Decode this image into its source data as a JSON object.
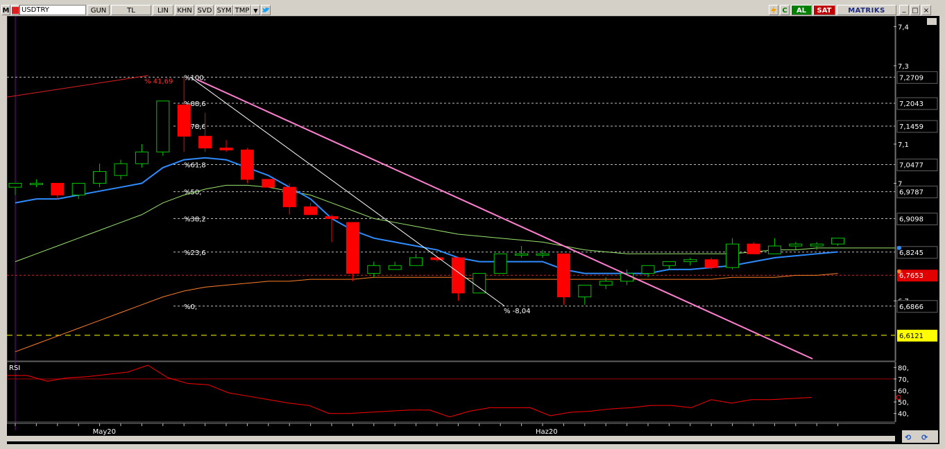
{
  "toolbar": {
    "m_label": "M",
    "symbol": "USDTRY",
    "buttons": [
      "GUN",
      "TL",
      "LIN",
      "KHN",
      "SVD",
      "SYM",
      "TMP"
    ],
    "refresh_icon": "refresh-icon",
    "c_label": "C",
    "buy_label": "AL",
    "sell_label": "SAT",
    "brand": "MATRIKS",
    "window_controls": [
      "_",
      "□",
      "×"
    ]
  },
  "colors": {
    "up_candle": "#00c800",
    "down_candle": "#ff0000",
    "ma_fast": "#2f8cff",
    "ma_mid": "#9ae66b",
    "ma_slow": "#ff7f27",
    "trendline": "#ff80d0",
    "fib_line": "#ffffff",
    "rsi_line": "#ff0000",
    "yellow_line": "#ffff00",
    "red_level": "#ff3030"
  },
  "chart": {
    "price_axis_ticks": [
      "7,4",
      "7,3",
      "7,1",
      "7",
      "6,7"
    ],
    "price_tick_values": [
      7.4,
      7.3,
      7.1,
      7.0,
      6.7
    ],
    "level_labels": [
      {
        "value": 7.2709,
        "text": "7,2709",
        "style": "plain"
      },
      {
        "value": 7.2043,
        "text": "7,2043",
        "style": "plain"
      },
      {
        "value": 7.1459,
        "text": "7,1459",
        "style": "plain"
      },
      {
        "value": 7.0477,
        "text": "7,0477",
        "style": "plain"
      },
      {
        "value": 6.9787,
        "text": "6,9787",
        "style": "plain"
      },
      {
        "value": 6.9098,
        "text": "6,9098",
        "style": "plain"
      },
      {
        "value": 6.8245,
        "text": "6,8245",
        "style": "plain"
      },
      {
        "value": 6.7653,
        "text": "6,7653",
        "style": "red"
      },
      {
        "value": 6.6866,
        "text": "6,6866",
        "style": "plain"
      },
      {
        "value": 6.6121,
        "text": "6,6121",
        "style": "yellow"
      }
    ],
    "fib_labels": [
      {
        "value": 7.2709,
        "text": "%100,"
      },
      {
        "value": 7.2043,
        "text": "%88,6"
      },
      {
        "value": 7.1459,
        "text": "%78,6"
      },
      {
        "value": 7.0477,
        "text": "%61,8"
      },
      {
        "value": 6.9787,
        "text": "%50,"
      },
      {
        "value": 6.9098,
        "text": "%38,2"
      },
      {
        "value": 6.8245,
        "text": "%23,6"
      },
      {
        "value": 6.6866,
        "text": "%0,"
      }
    ],
    "annotations": [
      "% 41,69",
      "% -8,04"
    ],
    "candles": [
      {
        "o": 6.99,
        "h": 7.0,
        "l": 6.97,
        "c": 7.0
      },
      {
        "o": 7.0,
        "h": 7.01,
        "l": 6.99,
        "c": 7.0
      },
      {
        "o": 7.0,
        "h": 7.0,
        "l": 6.96,
        "c": 6.97
      },
      {
        "o": 6.97,
        "h": 7.0,
        "l": 6.96,
        "c": 7.0
      },
      {
        "o": 7.0,
        "h": 7.05,
        "l": 6.99,
        "c": 7.03
      },
      {
        "o": 7.02,
        "h": 7.06,
        "l": 7.01,
        "c": 7.05
      },
      {
        "o": 7.05,
        "h": 7.1,
        "l": 7.04,
        "c": 7.08
      },
      {
        "o": 7.08,
        "h": 7.21,
        "l": 7.07,
        "c": 7.21
      },
      {
        "o": 7.2,
        "h": 7.27,
        "l": 7.08,
        "c": 7.12
      },
      {
        "o": 7.12,
        "h": 7.18,
        "l": 7.08,
        "c": 7.09
      },
      {
        "o": 7.09,
        "h": 7.11,
        "l": 7.08,
        "c": 7.085
      },
      {
        "o": 7.085,
        "h": 7.09,
        "l": 7.0,
        "c": 7.01
      },
      {
        "o": 7.01,
        "h": 7.01,
        "l": 6.99,
        "c": 6.99
      },
      {
        "o": 6.99,
        "h": 7.0,
        "l": 6.92,
        "c": 6.94
      },
      {
        "o": 6.94,
        "h": 6.95,
        "l": 6.92,
        "c": 6.92
      },
      {
        "o": 6.915,
        "h": 6.92,
        "l": 6.85,
        "c": 6.91
      },
      {
        "o": 6.9,
        "h": 6.9,
        "l": 6.75,
        "c": 6.77
      },
      {
        "o": 6.77,
        "h": 6.8,
        "l": 6.76,
        "c": 6.79
      },
      {
        "o": 6.78,
        "h": 6.8,
        "l": 6.78,
        "c": 6.79
      },
      {
        "o": 6.79,
        "h": 6.82,
        "l": 6.79,
        "c": 6.81
      },
      {
        "o": 6.81,
        "h": 6.81,
        "l": 6.8,
        "c": 6.805
      },
      {
        "o": 6.81,
        "h": 6.81,
        "l": 6.7,
        "c": 6.72
      },
      {
        "o": 6.72,
        "h": 6.77,
        "l": 6.72,
        "c": 6.77
      },
      {
        "o": 6.77,
        "h": 6.82,
        "l": 6.77,
        "c": 6.82
      },
      {
        "o": 6.82,
        "h": 6.84,
        "l": 6.81,
        "c": 6.82
      },
      {
        "o": 6.82,
        "h": 6.83,
        "l": 6.81,
        "c": 6.82
      },
      {
        "o": 6.82,
        "h": 6.82,
        "l": 6.69,
        "c": 6.71
      },
      {
        "o": 6.71,
        "h": 6.74,
        "l": 6.69,
        "c": 6.74
      },
      {
        "o": 6.74,
        "h": 6.76,
        "l": 6.73,
        "c": 6.75
      },
      {
        "o": 6.75,
        "h": 6.78,
        "l": 6.74,
        "c": 6.77
      },
      {
        "o": 6.77,
        "h": 6.79,
        "l": 6.76,
        "c": 6.79
      },
      {
        "o": 6.79,
        "h": 6.8,
        "l": 6.78,
        "c": 6.8
      },
      {
        "o": 6.8,
        "h": 6.81,
        "l": 6.79,
        "c": 6.805
      },
      {
        "o": 6.805,
        "h": 6.81,
        "l": 6.78,
        "c": 6.785
      },
      {
        "o": 6.785,
        "h": 6.86,
        "l": 6.78,
        "c": 6.845
      },
      {
        "o": 6.845,
        "h": 6.85,
        "l": 6.82,
        "c": 6.82
      },
      {
        "o": 6.82,
        "h": 6.86,
        "l": 6.82,
        "c": 6.84
      },
      {
        "o": 6.84,
        "h": 6.85,
        "l": 6.83,
        "c": 6.845
      },
      {
        "o": 6.84,
        "h": 6.85,
        "l": 6.83,
        "c": 6.845
      },
      {
        "o": 6.845,
        "h": 6.86,
        "l": 6.84,
        "c": 6.86
      }
    ],
    "ma_fast": [
      6.95,
      6.96,
      6.96,
      6.97,
      6.98,
      6.99,
      7.0,
      7.04,
      7.06,
      7.065,
      7.06,
      7.04,
      7.02,
      6.99,
      6.96,
      6.91,
      6.88,
      6.86,
      6.85,
      6.84,
      6.83,
      6.81,
      6.8,
      6.8,
      6.8,
      6.8,
      6.78,
      6.77,
      6.77,
      6.77,
      6.77,
      6.78,
      6.78,
      6.785,
      6.79,
      6.8,
      6.81,
      6.815,
      6.82,
      6.825
    ],
    "ma_mid": [
      6.8,
      6.82,
      6.84,
      6.86,
      6.88,
      6.9,
      6.92,
      6.95,
      6.97,
      6.985,
      6.995,
      6.995,
      6.99,
      6.98,
      6.97,
      6.95,
      6.93,
      6.91,
      6.9,
      6.89,
      6.88,
      6.87,
      6.865,
      6.86,
      6.855,
      6.85,
      6.84,
      6.83,
      6.825,
      6.82,
      6.82,
      6.82,
      6.82,
      6.82,
      6.82,
      6.825,
      6.83,
      6.83,
      6.835,
      6.835
    ],
    "ma_slow": [
      6.57,
      6.59,
      6.61,
      6.63,
      6.65,
      6.67,
      6.69,
      6.71,
      6.725,
      6.735,
      6.74,
      6.745,
      6.75,
      6.75,
      6.755,
      6.755,
      6.755,
      6.76,
      6.76,
      6.76,
      6.76,
      6.76,
      6.755,
      6.755,
      6.755,
      6.755,
      6.755,
      6.755,
      6.755,
      6.755,
      6.755,
      6.755,
      6.755,
      6.755,
      6.76,
      6.76,
      6.76,
      6.765,
      6.765,
      6.77
    ],
    "x_labels": [
      {
        "index": 4,
        "text": "May20"
      },
      {
        "index": 25,
        "text": "Haz20"
      }
    ]
  },
  "rsi": {
    "title": "RSI",
    "ticks": [
      "80,",
      "70,",
      "60,",
      "50,",
      "40,"
    ],
    "tick_values": [
      80,
      70,
      60,
      50,
      40
    ],
    "threshold_values": [
      70
    ],
    "values": [
      73,
      73,
      68,
      71,
      72,
      74,
      76,
      82,
      71,
      66,
      65,
      58,
      55,
      52,
      49,
      47,
      40,
      40,
      41,
      42,
      43,
      43,
      37,
      42,
      45,
      45,
      45,
      38,
      41,
      42,
      44,
      45,
      47,
      47,
      45,
      52,
      49,
      52,
      52,
      53,
      54
    ]
  }
}
